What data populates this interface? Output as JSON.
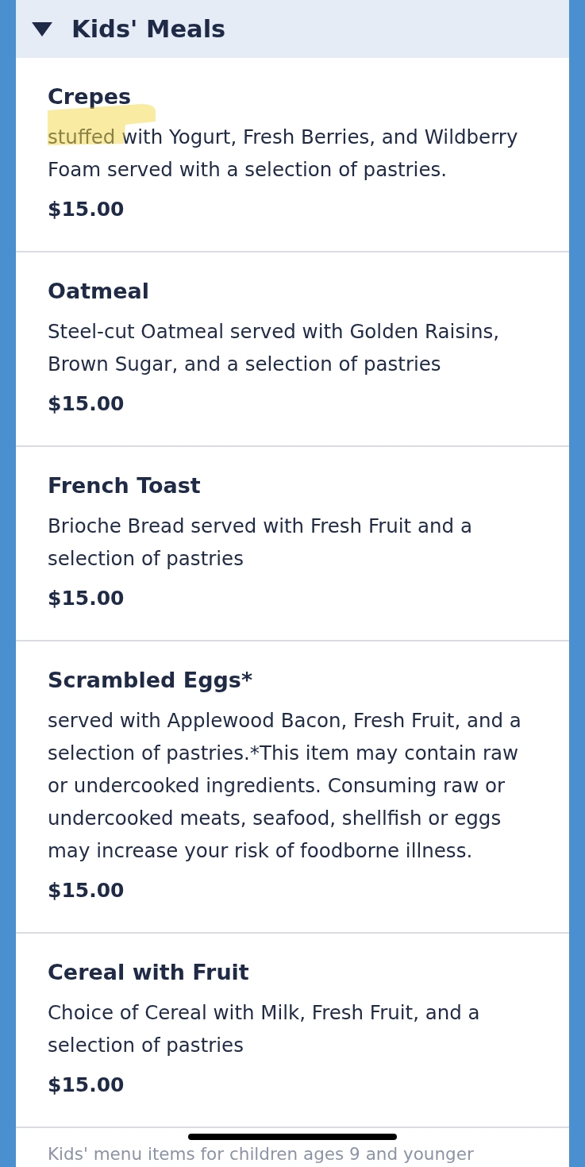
{
  "section": {
    "title": "Kids' Meals",
    "expanded": true
  },
  "items": [
    {
      "name": "Crepes",
      "description": "stuffed with Yogurt, Fresh Berries, and Wildberry Foam served with a selection of pastries.",
      "price": "$15.00",
      "highlighted": true
    },
    {
      "name": "Oatmeal",
      "description": "Steel-cut Oatmeal served with Golden Raisins, Brown Sugar, and a selection of pastries",
      "price": "$15.00",
      "highlighted": false
    },
    {
      "name": "French Toast",
      "description": "Brioche Bread served with Fresh Fruit and a selection of pastries",
      "price": "$15.00",
      "highlighted": false
    },
    {
      "name": "Scrambled Eggs*",
      "description": "served with Applewood Bacon, Fresh Fruit, and a selection of pastries.*This item may contain raw or undercooked ingredients. Consuming raw or undercooked meats, seafood, shellfish or eggs may increase your risk of foodborne illness.",
      "price": "$15.00",
      "highlighted": false
    },
    {
      "name": "Cereal with Fruit",
      "description": "Choice of Cereal with Milk, Fresh Fruit, and a selection of pastries",
      "price": "$15.00",
      "highlighted": false
    }
  ],
  "footnote": "Kids' menu items for children ages 9 and younger"
}
